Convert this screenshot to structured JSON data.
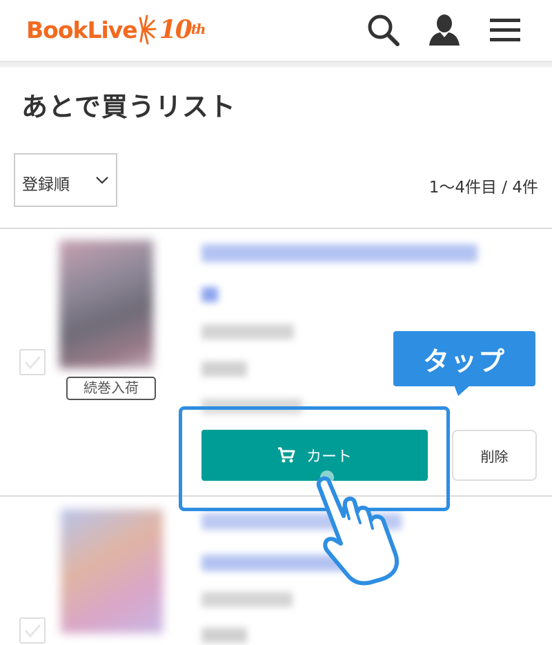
{
  "header": {
    "logo_text": "BookLive",
    "logo_anniv": "10",
    "logo_anniv_suffix": "th",
    "icons": [
      "search-icon",
      "user-icon",
      "menu-icon"
    ]
  },
  "page": {
    "title": "あとで買うリスト"
  },
  "sort": {
    "selected": "登録順"
  },
  "result_count": "1〜4件目 / 4件",
  "items": [
    {
      "badge": "続巻入荷",
      "cart_label": "カート",
      "delete_label": "削除"
    },
    {}
  ],
  "annotation": {
    "tap_label": "タップ"
  },
  "colors": {
    "brand": "#f26a1f",
    "cart": "#009d97",
    "annotation": "#2e8ee2"
  }
}
